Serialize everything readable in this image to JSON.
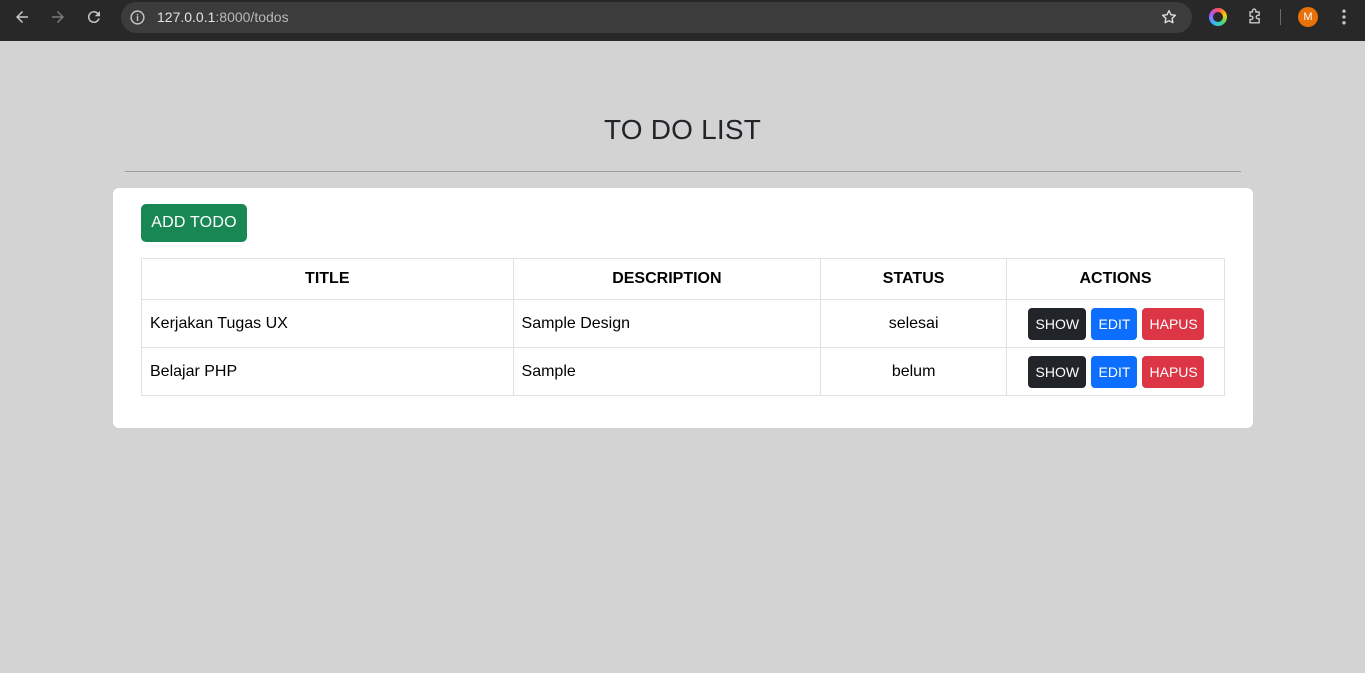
{
  "browser": {
    "url_host": "127.0.0.1",
    "url_rest": ":8000/todos",
    "avatar_letter": "M"
  },
  "page": {
    "title": "TO DO LIST",
    "add_button": "ADD TODO"
  },
  "table": {
    "headers": [
      "TITLE",
      "DESCRIPTION",
      "STATUS",
      "ACTIONS"
    ],
    "rows": [
      {
        "title": "Kerjakan Tugas UX",
        "description": "Sample Design",
        "status": "selesai"
      },
      {
        "title": "Belajar PHP",
        "description": "Sample",
        "status": "belum"
      }
    ],
    "actions": {
      "show": "SHOW",
      "edit": "EDIT",
      "delete": "HAPUS"
    }
  },
  "colors": {
    "add": "#198754",
    "show": "#212529",
    "edit": "#0d6efd",
    "delete": "#dc3545"
  },
  "icons": [
    "back-arrow-icon",
    "forward-arrow-icon",
    "reload-icon",
    "site-info-icon",
    "star-icon",
    "color-extension-icon",
    "puzzle-icon",
    "kebab-menu-icon"
  ]
}
